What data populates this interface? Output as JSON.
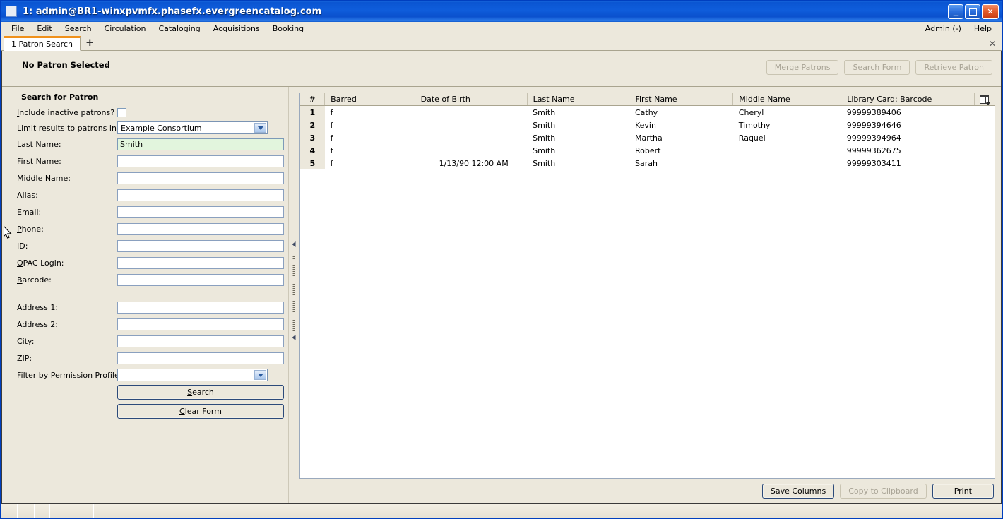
{
  "window": {
    "title": "1: admin@BR1-winxpvmfx.phasefx.evergreencatalog.com",
    "minimize_label": "_",
    "maximize_label": "",
    "close_label": "✕"
  },
  "menubar": {
    "items": [
      {
        "label": "File",
        "accel": "F"
      },
      {
        "label": "Edit",
        "accel": "E"
      },
      {
        "label": "Search",
        "accel": "r"
      },
      {
        "label": "Circulation",
        "accel": "C"
      },
      {
        "label": "Cataloging",
        "accel": "g"
      },
      {
        "label": "Acquisitions",
        "accel": "A"
      },
      {
        "label": "Booking",
        "accel": "B"
      }
    ],
    "admin_label": "Admin (-)",
    "help_label": "Help"
  },
  "tabs": {
    "items": [
      {
        "label": "1 Patron Search",
        "active": true
      }
    ],
    "new_tab_label": "+",
    "close_label": "✕"
  },
  "patron_header": {
    "title": "No Patron Selected",
    "buttons": [
      {
        "label": "Merge Patrons",
        "enabled": false
      },
      {
        "label": "Search Form",
        "enabled": false
      },
      {
        "label": "Retrieve Patron",
        "enabled": false
      }
    ]
  },
  "search_form": {
    "legend": "Search for Patron",
    "include_inactive_label": "Include inactive patrons?",
    "include_inactive_checked": false,
    "limit_results_label": "Limit results to patrons in",
    "limit_results_value": "Example Consortium",
    "fields": [
      {
        "label": "Last Name:",
        "value": "Smith",
        "filled": true
      },
      {
        "label": "First Name:",
        "value": "",
        "filled": false
      },
      {
        "label": "Middle Name:",
        "value": "",
        "filled": false
      },
      {
        "label": "Alias:",
        "value": "",
        "filled": false
      },
      {
        "label": "Email:",
        "value": "",
        "filled": false
      },
      {
        "label": "Phone:",
        "value": "",
        "filled": false
      },
      {
        "label": "ID:",
        "value": "",
        "filled": false
      },
      {
        "label": "OPAC Login:",
        "value": "",
        "filled": false
      },
      {
        "label": "Barcode:",
        "value": "",
        "filled": false
      }
    ],
    "address_fields": [
      {
        "label": "Address 1:",
        "value": ""
      },
      {
        "label": "Address 2:",
        "value": ""
      },
      {
        "label": "City:",
        "value": ""
      },
      {
        "label": "ZIP:",
        "value": ""
      }
    ],
    "permission_profile_label": "Filter by Permission Profile:",
    "permission_profile_value": "",
    "search_button": "Search",
    "clear_button": "Clear Form"
  },
  "results": {
    "columns": [
      "#",
      "Barred",
      "Date of Birth",
      "Last Name",
      "First Name",
      "Middle Name",
      "Library Card: Barcode"
    ],
    "rows": [
      {
        "num": "1",
        "barred": "f",
        "dob": "",
        "last": "Smith",
        "first": "Cathy",
        "middle": "Cheryl",
        "barcode": "99999389406"
      },
      {
        "num": "2",
        "barred": "f",
        "dob": "",
        "last": "Smith",
        "first": "Kevin",
        "middle": "Timothy",
        "barcode": "99999394646"
      },
      {
        "num": "3",
        "barred": "f",
        "dob": "",
        "last": "Smith",
        "first": "Martha",
        "middle": "Raquel",
        "barcode": "99999394964"
      },
      {
        "num": "4",
        "barred": "f",
        "dob": "",
        "last": "Smith",
        "first": "Robert",
        "middle": "",
        "barcode": "99999362675"
      },
      {
        "num": "5",
        "barred": "f",
        "dob": "1/13/90 12:00 AM",
        "last": "Smith",
        "first": "Sarah",
        "middle": "",
        "barcode": "99999303411"
      }
    ],
    "footer_buttons": [
      {
        "label": "Save Columns",
        "enabled": true
      },
      {
        "label": "Copy to Clipboard",
        "enabled": false
      },
      {
        "label": "Print",
        "enabled": true
      }
    ]
  },
  "colors": {
    "chrome": "#ece8dc",
    "titlebar": "#0a55d2",
    "tab_accent": "#f0911b",
    "filled_field": "#e2f5dd"
  }
}
